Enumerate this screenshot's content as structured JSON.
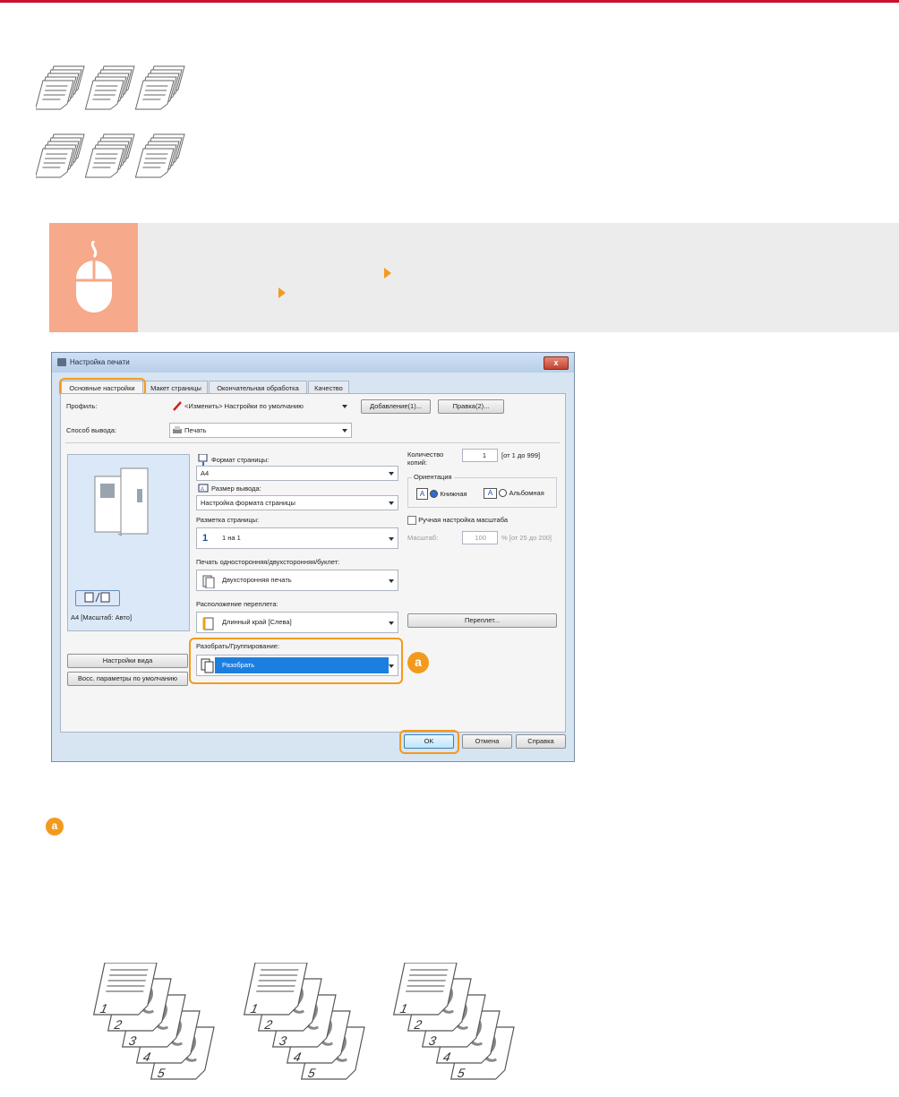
{
  "dialog": {
    "title": "Настройка печати",
    "close_label": "x",
    "tabs": [
      "Основные настройки",
      "Макет страницы",
      "Окончательная обработка",
      "Качество"
    ],
    "profile_label": "Профиль:",
    "profile_value": "<Изменить> Настройки по умолчанию",
    "add_button": "Добавление(1)...",
    "edit_button": "Правка(2)...",
    "output_method_label": "Способ вывода:",
    "output_method_value": "Печать",
    "page_size_label": "Формат страницы:",
    "page_size_value": "A4",
    "output_size_label": "Размер вывода:",
    "output_size_value": "Настройка формата страницы",
    "page_layout_label": "Разметка страницы:",
    "page_layout_number": "1",
    "page_layout_value": "1 на 1",
    "duplex_label": "Печать односторонняя/двухсторонняя/буклет:",
    "duplex_value": "Двухсторонняя печать",
    "binding_label": "Расположение переплета:",
    "binding_value": "Длинный край [Слева]",
    "collate_label": "Разобрать/Группирование:",
    "collate_value": "Разобрать",
    "copies_label": "Количество копий:",
    "copies_value": "1",
    "copies_range": "[от 1 до 999]",
    "orientation_label": "Ориентация",
    "portrait_label": "Книжная",
    "landscape_label": "Альбомная",
    "manual_scale_label": "Ручная настройка масштаба",
    "scale_label": "Масштаб:",
    "scale_value": "100",
    "scale_range": "% [от 25 до 200]",
    "binding_button": "Переплет...",
    "preview_caption": "A4 [Масштаб: Авто]",
    "view_settings_button": "Настройки вида",
    "restore_defaults_button": "Восс. параметры по умолчанию",
    "ok_button": "OK",
    "cancel_button": "Отмена",
    "help_button": "Справка"
  },
  "annotation": {
    "marker": "a"
  },
  "illustration": {
    "page_numbers": [
      "1",
      "2",
      "3",
      "4",
      "5"
    ]
  },
  "colors": {
    "accent": "#f39a1e",
    "hint_icon_bg": "#f6a98b",
    "hint_bg": "#ececec",
    "top_rule": "#c8102e",
    "selection": "#1c7fe0"
  }
}
